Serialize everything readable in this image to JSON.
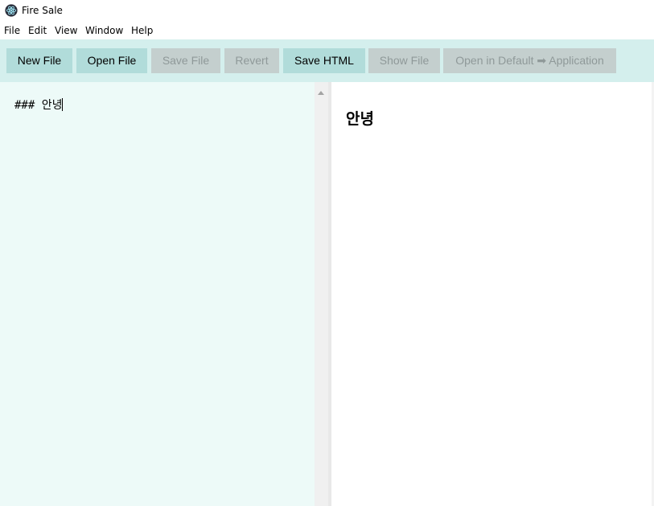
{
  "window": {
    "title": "Fire Sale"
  },
  "menu": [
    "File",
    "Edit",
    "View",
    "Window",
    "Help"
  ],
  "toolbar": {
    "new_file": "New File",
    "open_file": "Open File",
    "save_file": "Save File",
    "revert": "Revert",
    "save_html": "Save HTML",
    "show_file": "Show File",
    "open_in_default": "Open in Default ➡ Application"
  },
  "editor": {
    "content": "### 안녕"
  },
  "preview": {
    "heading": "안녕"
  },
  "colors": {
    "toolbar_bg": "#d4efed",
    "button_enabled": "#b1dcda",
    "button_disabled": "#c4cfce",
    "editor_bg": "#edfaf8"
  },
  "icons": {
    "app": "electron-logo-icon",
    "scroll_up": "scroll-up-arrow-icon"
  }
}
